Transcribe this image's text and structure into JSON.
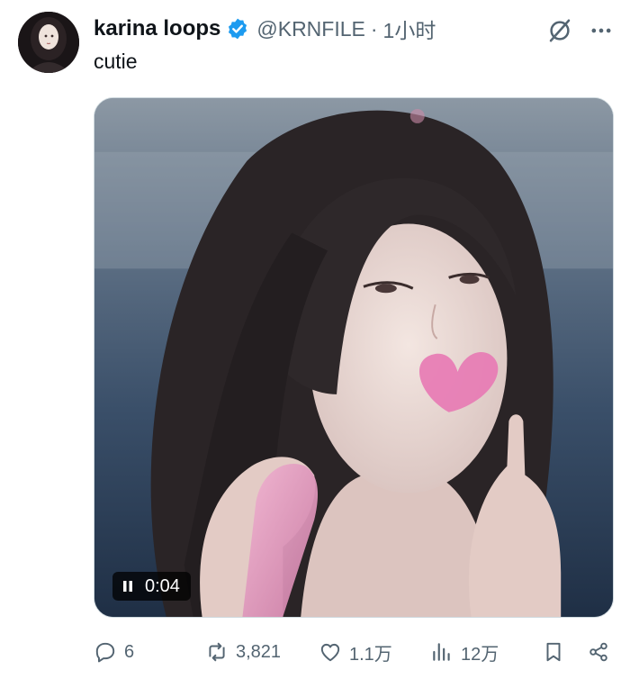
{
  "post": {
    "author": {
      "display_name": "karina loops",
      "handle": "@KRNFILE",
      "verified": true,
      "avatar_icon": "avatar-photo"
    },
    "separator": "·",
    "timestamp": "1小时",
    "text": "cutie",
    "media": {
      "type": "video",
      "timer": "0:04",
      "state": "playing",
      "accent_heart_color": "#e77bb4"
    },
    "actions": {
      "replies": "6",
      "reposts": "3,821",
      "likes": "1.1万",
      "views": "12万"
    }
  },
  "colors": {
    "text_primary": "#0f1419",
    "text_secondary": "#536471",
    "verified_blue": "#1d9bf0"
  },
  "icons": {
    "verified": "verified-badge-icon",
    "grok": "grok-icon",
    "more": "more-icon",
    "pause": "pause-icon",
    "reply": "reply-icon",
    "repost": "repost-icon",
    "like": "like-icon",
    "views": "views-icon",
    "bookmark": "bookmark-icon",
    "share": "share-icon"
  }
}
